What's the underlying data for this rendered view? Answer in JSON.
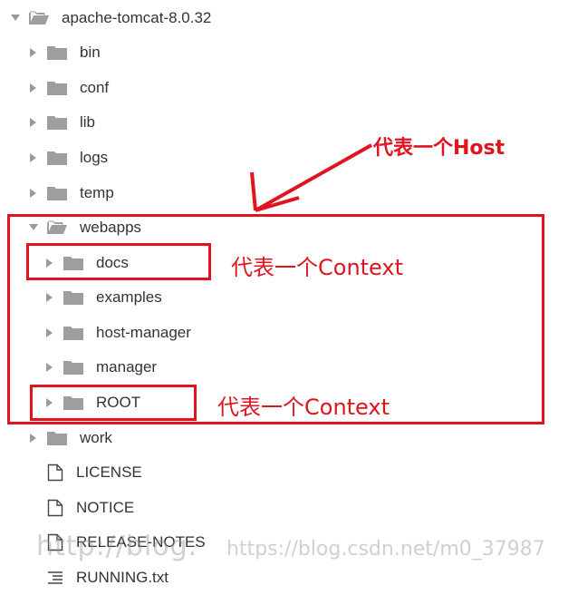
{
  "tree": {
    "root": {
      "label": "apache-tomcat-8.0.32",
      "icon": "folder-open-icon",
      "expanded": true
    },
    "items": [
      {
        "label": "bin",
        "icon": "folder-icon",
        "type": "folder",
        "expanded": false
      },
      {
        "label": "conf",
        "icon": "folder-icon",
        "type": "folder",
        "expanded": false
      },
      {
        "label": "lib",
        "icon": "folder-icon",
        "type": "folder",
        "expanded": false
      },
      {
        "label": "logs",
        "icon": "folder-icon",
        "type": "folder",
        "expanded": false
      },
      {
        "label": "temp",
        "icon": "folder-icon",
        "type": "folder",
        "expanded": false
      },
      {
        "label": "webapps",
        "icon": "folder-open-icon",
        "type": "folder",
        "expanded": true,
        "children": [
          {
            "label": "docs",
            "icon": "folder-icon"
          },
          {
            "label": "examples",
            "icon": "folder-icon"
          },
          {
            "label": "host-manager",
            "icon": "folder-icon"
          },
          {
            "label": "manager",
            "icon": "folder-icon"
          },
          {
            "label": "ROOT",
            "icon": "folder-icon"
          }
        ]
      },
      {
        "label": "work",
        "icon": "folder-icon",
        "type": "folder",
        "expanded": false
      },
      {
        "label": "LICENSE",
        "icon": "file-icon",
        "type": "file"
      },
      {
        "label": "NOTICE",
        "icon": "file-icon",
        "type": "file"
      },
      {
        "label": "RELEASE-NOTES",
        "icon": "file-icon",
        "type": "file"
      },
      {
        "label": "RUNNING.txt",
        "icon": "text-file-icon",
        "type": "file"
      }
    ]
  },
  "annotations": {
    "host": "代表一个Host",
    "context_docs": "代表一个Context",
    "context_root": "代表一个Context"
  },
  "watermark": {
    "text_1": "http://blog.",
    "text_2": "https://blog.csdn.net/m0_37987"
  },
  "colors": {
    "annotation_red": "#e0141e",
    "folder_gray": "#9e9e9e",
    "text": "#333333"
  }
}
